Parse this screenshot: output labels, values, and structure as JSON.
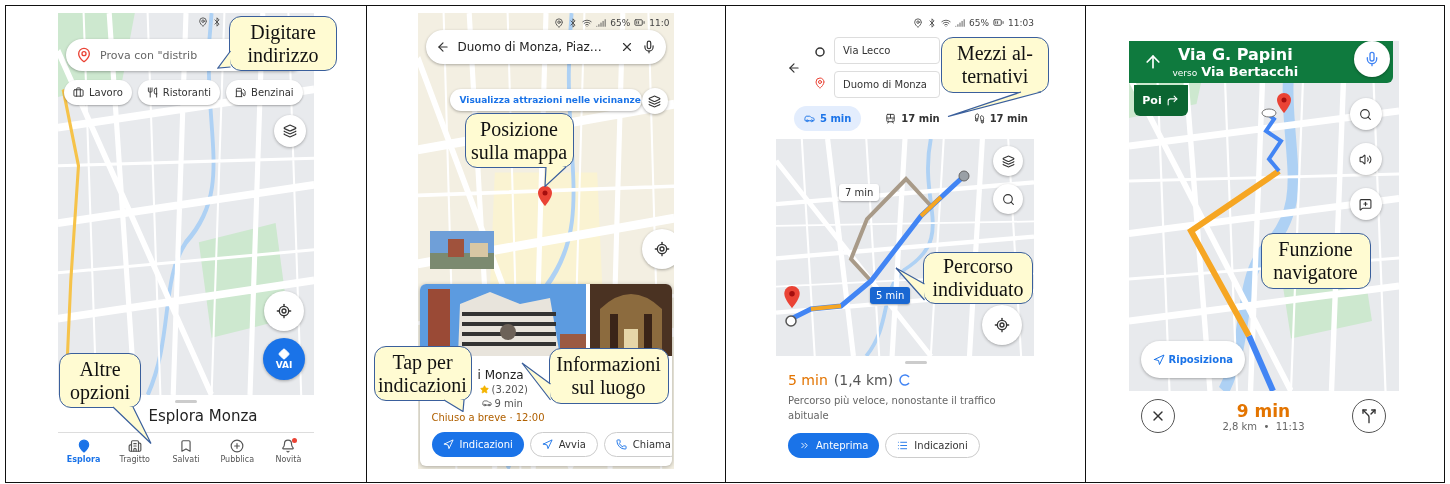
{
  "panels": [
    {
      "kind": "explore",
      "search": {
        "placeholder": "Prova con \"distrib"
      },
      "chips": [
        {
          "label": "Lavoro"
        },
        {
          "label": "Ristoranti"
        },
        {
          "label": "Benzinai"
        }
      ],
      "go_button": "VAI",
      "sheet_title": "Esplora Monza",
      "nav": [
        {
          "label": "Esplora",
          "selected": true
        },
        {
          "label": "Tragitto",
          "selected": false
        },
        {
          "label": "Salvati",
          "selected": false
        },
        {
          "label": "Pubblica",
          "selected": false
        },
        {
          "label": "Novità",
          "selected": false
        }
      ],
      "callouts": [
        {
          "lines": [
            "Digitare",
            "indirizzo"
          ]
        },
        {
          "lines": [
            "Altre",
            "opzioni"
          ]
        }
      ]
    },
    {
      "kind": "place",
      "status": {
        "battery": "65%",
        "time": "11:0"
      },
      "search": {
        "value": "Duomo di Monza, Piaz…"
      },
      "nearby_button": "Visualizza attrazioni nelle vicinanze",
      "place": {
        "title": "i Monza",
        "reviews": "(3.202)",
        "travel": "9 min",
        "hours": "Chiuso a breve · 12:00"
      },
      "actions": [
        {
          "label": "Indicazioni",
          "kind": "primary"
        },
        {
          "label": "Avvia",
          "kind": "secondary"
        },
        {
          "label": "Chiama",
          "kind": "secondary"
        }
      ],
      "callouts": [
        {
          "lines": [
            "Posizione",
            "sulla mappa"
          ]
        },
        {
          "lines": [
            "Tap per",
            "indicazioni"
          ]
        },
        {
          "lines": [
            "Informazioni",
            "sul luogo"
          ]
        }
      ]
    },
    {
      "kind": "route",
      "status": {
        "battery": "65%",
        "time": "11:03"
      },
      "from": "Via Lecco",
      "to": "Duomo di Monza",
      "modes": [
        {
          "label": "5 min",
          "selected": true
        },
        {
          "label": "17 min",
          "selected": false
        },
        {
          "label": "17 min",
          "selected": false
        }
      ],
      "map_badges": [
        {
          "label": "7 min",
          "kind": "alternative"
        },
        {
          "label": "5 min",
          "kind": "main"
        }
      ],
      "summary": {
        "duration": "5 min",
        "distance": "(1,4 km)",
        "note": "Percorso più veloce, nonostante il traffico abituale"
      },
      "actions": [
        {
          "label": "Anteprima",
          "kind": "primary"
        },
        {
          "label": "Indicazioni",
          "kind": "secondary"
        }
      ],
      "callouts": [
        {
          "lines": [
            "Mezzi al-",
            "ternativi"
          ]
        },
        {
          "lines": [
            "Percorso",
            "individuato"
          ]
        }
      ]
    },
    {
      "kind": "navigation",
      "street": "Via G. Papini",
      "toward_prefix": "verso",
      "toward": "Via Bertacchi",
      "next": "Poi",
      "recenter": "Riposiziona",
      "eta": "9 min",
      "trip": "2,8 km  •  11:13",
      "callouts": [
        {
          "lines": [
            "Funzione",
            "navigatore"
          ]
        }
      ]
    }
  ]
}
